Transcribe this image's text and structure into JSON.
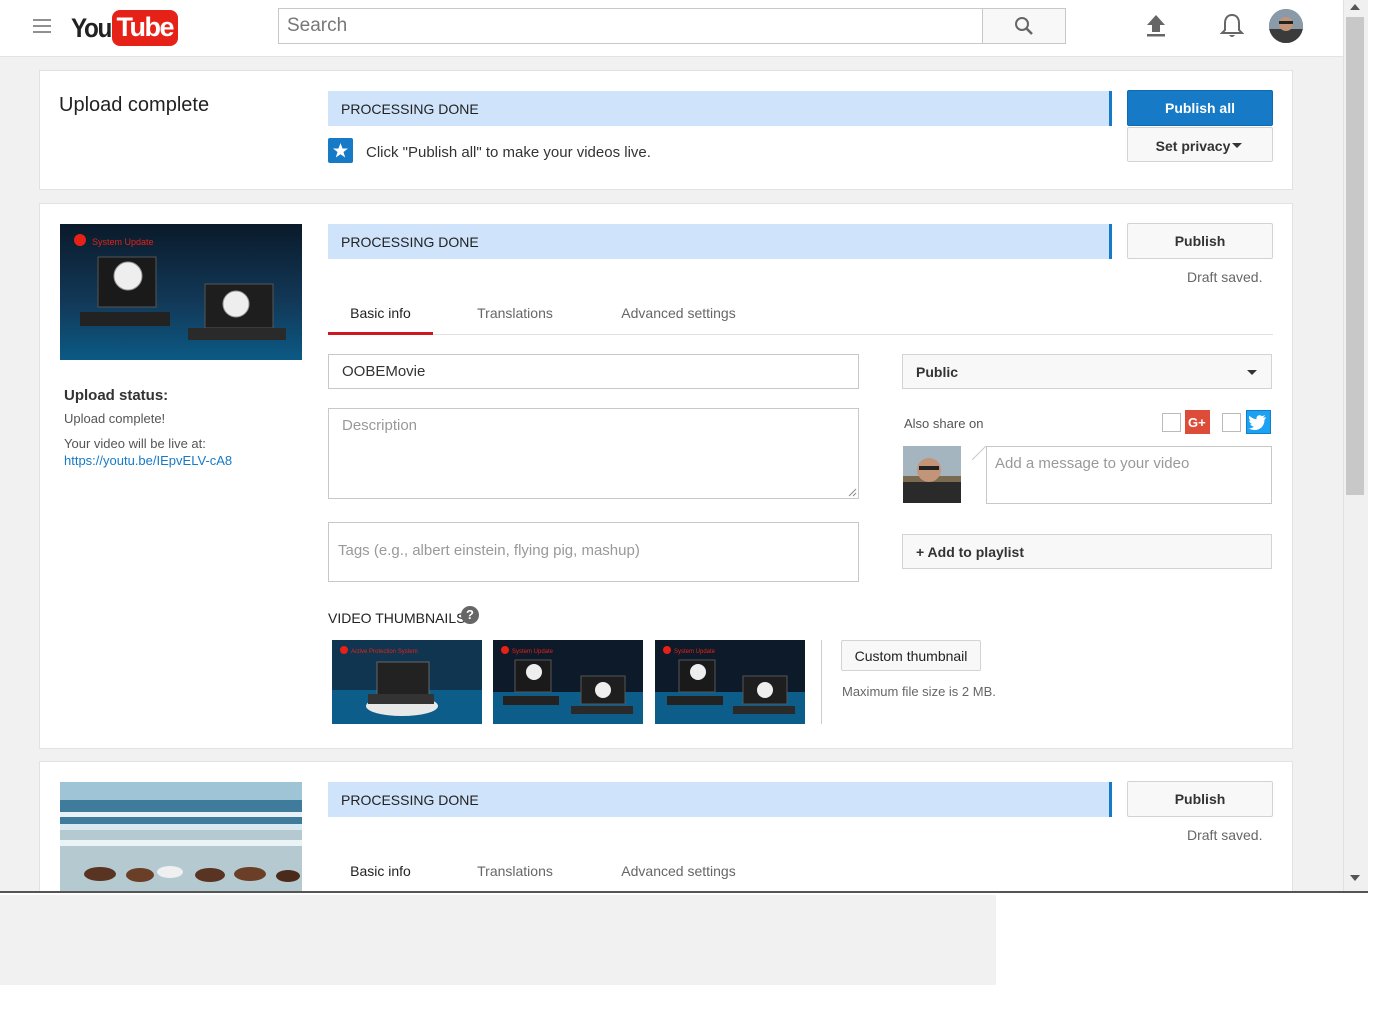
{
  "masthead": {
    "logo_you": "You",
    "logo_tube": "Tube",
    "search_placeholder": "Search"
  },
  "summary": {
    "title": "Upload complete",
    "status": "PROCESSING DONE",
    "hint": "Click \"Publish all\" to make your videos live.",
    "publish_all_label": "Publish all",
    "set_privacy_label": "Set privacy"
  },
  "video1": {
    "thumb_caption": "System Update",
    "status": "PROCESSING DONE",
    "publish_label": "Publish",
    "draft_text": "Draft saved.",
    "tabs": [
      "Basic info",
      "Translations",
      "Advanced settings"
    ],
    "title_value": "OOBEMovie",
    "description_placeholder": "Description",
    "tags_placeholder": "Tags (e.g., albert einstein, flying pig, mashup)",
    "privacy_value": "Public",
    "also_share_label": "Also share on",
    "message_placeholder": "Add a message to your video",
    "add_playlist_label": "+ Add to playlist",
    "upload_status_heading": "Upload status:",
    "upload_status_text": "Upload complete!",
    "live_at_text": "Your video will be live at:",
    "video_url": "https://youtu.be/IEpvELV-cA8",
    "thumbnails_heading": "VIDEO THUMBNAILS",
    "thumbnail_captions": [
      "Active Protection System",
      "System Update",
      "System Update"
    ],
    "custom_thumbnail_label": "Custom thumbnail",
    "max_file_size_text": "Maximum file size is 2 MB."
  },
  "video2": {
    "status": "PROCESSING DONE",
    "publish_label": "Publish",
    "draft_text": "Draft saved.",
    "tabs": [
      "Basic info",
      "Translations",
      "Advanced settings"
    ]
  },
  "colors": {
    "accent_blue": "#167ac6",
    "processing_bar": "#cfe4fa",
    "brand_red": "#e62117",
    "tab_underline": "#cc181e"
  },
  "icons": [
    "menu-icon",
    "search-icon",
    "upload-icon",
    "bell-icon",
    "star-icon",
    "help-icon",
    "google-plus-icon",
    "twitter-icon",
    "caret-down-icon"
  ]
}
